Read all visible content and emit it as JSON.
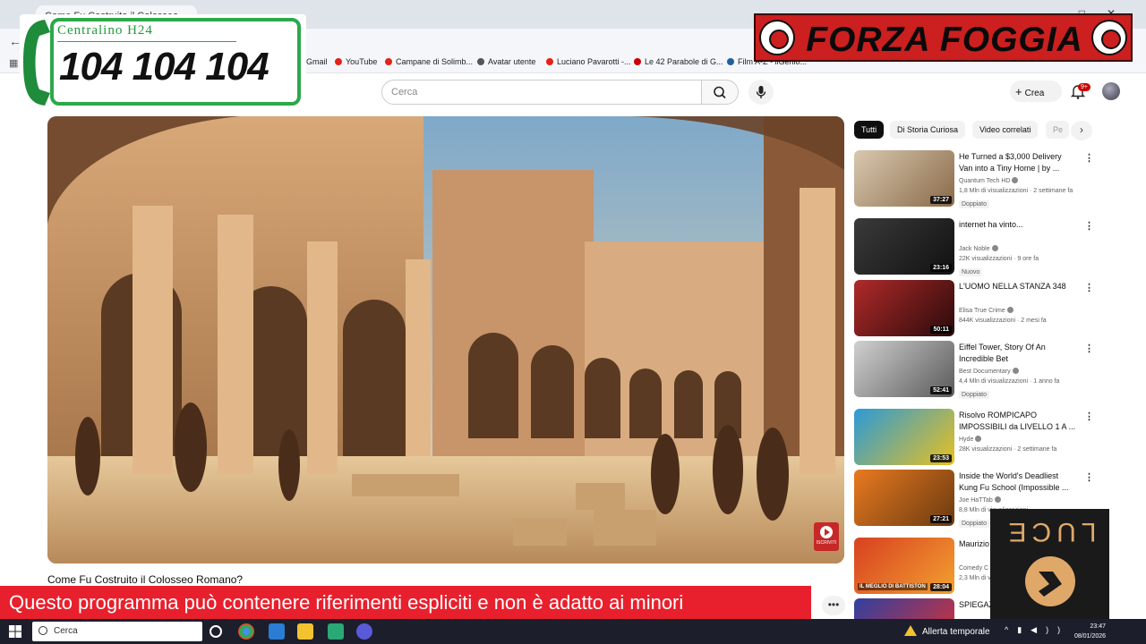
{
  "browser": {
    "tab_title": "Come Fu Costruito il Colosseo",
    "bookmarks": [
      "Gmail",
      "YouTube",
      "Campane di Solimb...",
      "Avatar utente",
      "Luciano Pavarotti -...",
      "Le 42 Parabole di G...",
      "Film A-Z - ilGenio..."
    ]
  },
  "youtube": {
    "search_placeholder": "Cerca",
    "create_label": "Crea",
    "notifications_badge": "9+"
  },
  "video": {
    "title": "Come Fu Costruito il Colosseo Romano?",
    "watermark_label": "ISCRIVITI"
  },
  "chips": [
    "Tutti",
    "Di Storia Curiosa",
    "Video correlati",
    "Pe"
  ],
  "recommendations": [
    {
      "title": "He Turned a $3,000 Delivery Van into a Tiny Home | by ...",
      "channel": "Quantum Tech HD",
      "meta": "1,8 Mln di visualizzazioni · 2 settimane fa",
      "badge": "Doppiato",
      "duration": "37:27",
      "colors": [
        "#d8c8b0",
        "#8a6a48"
      ]
    },
    {
      "title": "internet ha vinto...",
      "channel": "Jack Noble",
      "meta": "22K visualizzazioni · 9 ore fa",
      "badge": "Nuovo",
      "duration": "23:16",
      "colors": [
        "#3a3a3a",
        "#111111"
      ]
    },
    {
      "title": "L'UOMO NELLA STANZA 348",
      "channel": "Elisa True Crime",
      "meta": "844K visualizzazioni · 2 mesi fa",
      "badge": "",
      "duration": "50:11",
      "colors": [
        "#b02a2a",
        "#2a0a0a"
      ]
    },
    {
      "title": "Eiffel Tower, Story Of An Incredible Bet",
      "channel": "Best Documentary",
      "meta": "4,4 Mln di visualizzazioni · 1 anno fa",
      "badge": "Doppiato",
      "duration": "52:41",
      "colors": [
        "#d0d0d0",
        "#5a5a5a"
      ]
    },
    {
      "title": "Risolvo ROMPICAPO IMPOSSIBILI da LIVELLO 1 A ...",
      "channel": "Hyde",
      "meta": "28K visualizzazioni · 2 settimane fa",
      "badge": "",
      "duration": "23:53",
      "colors": [
        "#2a9ad8",
        "#e8c020"
      ]
    },
    {
      "title": "Inside the World's Deadliest Kung Fu School (Impossible ...",
      "channel": "Joe HaTTab",
      "meta": "8,8 Mln di visualizzazioni",
      "badge": "Doppiato",
      "duration": "27:21",
      "colors": [
        "#e87a20",
        "#6a3a10"
      ]
    },
    {
      "title": "Maurizio Battistoni",
      "channel": "Comedy C",
      "meta": "2,3 Mln di vi",
      "badge": "",
      "duration": "28:04",
      "thumb_text": "IL MEGLIO DI BATTISTON",
      "colors": [
        "#d84020",
        "#f2a030"
      ]
    },
    {
      "title": "SPIEGAZ MAGIE",
      "channel": "",
      "meta": "",
      "badge": "",
      "duration": "",
      "thumb_text": "CAMPIONE DEL MONDO",
      "colors": [
        "#3040a0",
        "#e03030"
      ]
    }
  ],
  "overlays": {
    "phone_label": "Centralino H24",
    "phone_number": "104 104 104",
    "forza_text": "FORZA FOGGIA",
    "disclaimer": "Questo programma  può contenere riferimenti espliciti e non è adatto ai minori",
    "luce_text": "LUCE"
  },
  "taskbar": {
    "search_label": "Cerca",
    "weather": "Allerta temporale",
    "time": "23:47",
    "date": "08/01/2026"
  }
}
